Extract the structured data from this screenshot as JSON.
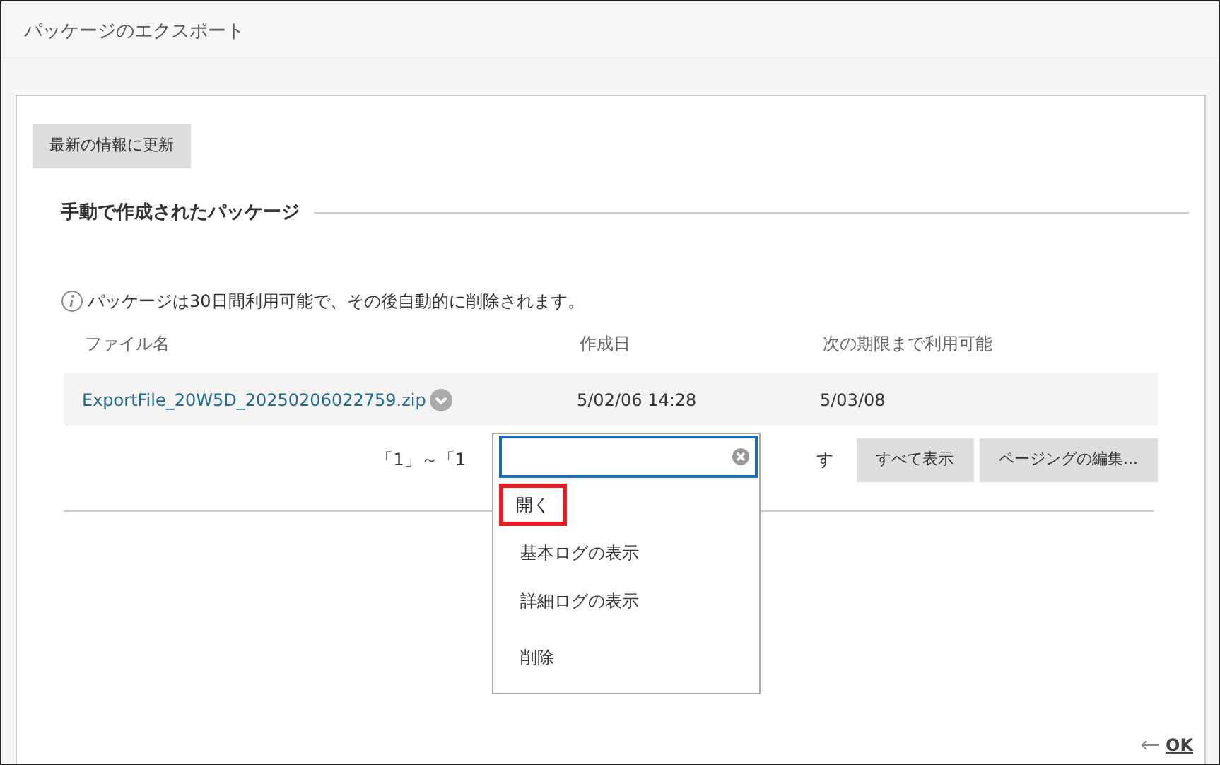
{
  "window": {
    "title": "パッケージのエクスポート"
  },
  "refresh_button": "最新の情報に更新",
  "section_title": "手動で作成されたパッケージ",
  "info": "パッケージは30日間利用可能で、その後自動的に削除されます。",
  "table": {
    "columns": [
      "ファイル名",
      "作成日",
      "次の期限まで利用可能"
    ],
    "rows": [
      {
        "file": "ExportFile_20W5D_20250206022759.zip",
        "created": "5/02/06 14:28",
        "available_until": "5/03/08"
      }
    ]
  },
  "pagination": {
    "text_before": "「1」～「1",
    "text_after": "す",
    "buttons": [
      "すべて表示",
      "ページングの編集..."
    ]
  },
  "context_menu": {
    "items": [
      {
        "label": "開く",
        "highlighted": true
      },
      {
        "label": "基本ログの表示",
        "highlighted": false
      },
      {
        "label": "詳細ログの表示",
        "highlighted": false
      },
      {
        "label": "削除",
        "highlighted": false
      }
    ]
  },
  "footer": {
    "ok_label": "OK"
  }
}
